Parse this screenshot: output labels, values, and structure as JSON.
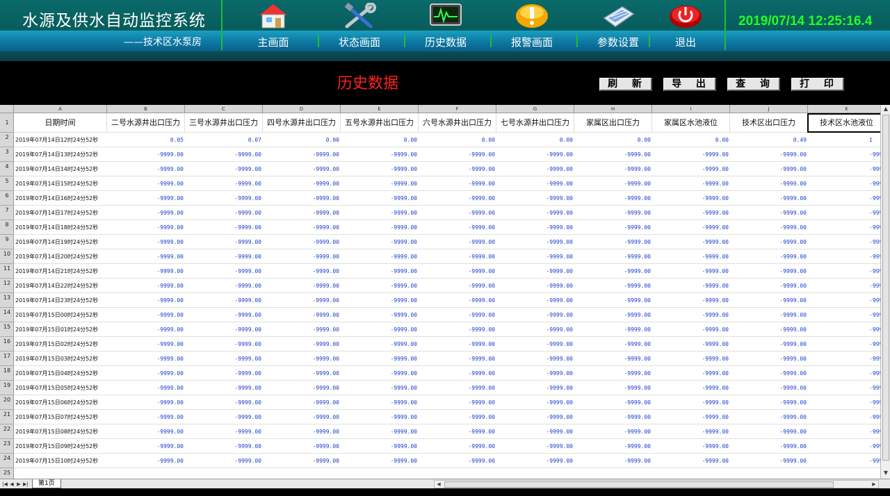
{
  "header": {
    "title": "水源及供水自动监控系统",
    "subtitle": "——技术区水泵房",
    "clock": "2019/07/14 12:25:16.4",
    "nav": [
      {
        "label": "主画面",
        "icon": "home-icon"
      },
      {
        "label": "状态画面",
        "icon": "tools-icon"
      },
      {
        "label": "历史数据",
        "icon": "monitor-icon"
      },
      {
        "label": "报警画面",
        "icon": "alarm-icon"
      },
      {
        "label": "参数设置",
        "icon": "keyboard-icon"
      },
      {
        "label": "退出",
        "icon": "power-icon"
      }
    ]
  },
  "toolbar": {
    "page_title": "历史数据",
    "refresh": "刷 新",
    "export": "导 出",
    "query": "查 询",
    "print": "打 印"
  },
  "sheet": {
    "col_letters": [
      "A",
      "B",
      "C",
      "D",
      "E",
      "F",
      "G",
      "H",
      "I",
      "J",
      "K"
    ],
    "headers": [
      "日期时间",
      "二号水源井出口压力",
      "三号水源井出口压力",
      "四号水源井出口压力",
      "五号水源井出口压力",
      "六号水源井出口压力",
      "七号水源井出口压力",
      "家属区出口压力",
      "家属区水池液位",
      "技术区出口压力",
      "技术区水池液位"
    ],
    "rows": [
      {
        "t": "2019年07月14日12时24分52秒",
        "v": [
          "0.05",
          "0.07",
          "0.00",
          "0.00",
          "0.00",
          "0.00",
          "0.00",
          "0.00",
          "0.49",
          "1"
        ]
      },
      {
        "t": "2019年07月14日13时24分52秒",
        "v": [
          "-9999.00",
          "-9999.00",
          "-9999.00",
          "-9999.00",
          "-9999.00",
          "-9999.00",
          "-9999.00",
          "-9999.00",
          "-9999.00",
          "-999"
        ]
      },
      {
        "t": "2019年07月14日14时24分52秒",
        "v": [
          "-9999.00",
          "-9999.00",
          "-9999.00",
          "-9999.00",
          "-9999.00",
          "-9999.00",
          "-9999.00",
          "-9999.00",
          "-9999.00",
          "-999"
        ]
      },
      {
        "t": "2019年07月14日15时24分52秒",
        "v": [
          "-9999.00",
          "-9999.00",
          "-9999.00",
          "-9999.00",
          "-9999.00",
          "-9999.00",
          "-9999.00",
          "-9999.00",
          "-9999.00",
          "-999"
        ]
      },
      {
        "t": "2019年07月14日16时24分52秒",
        "v": [
          "-9999.00",
          "-9999.00",
          "-9999.00",
          "-9999.00",
          "-9999.00",
          "-9999.00",
          "-9999.00",
          "-9999.00",
          "-9999.00",
          "-999"
        ]
      },
      {
        "t": "2019年07月14日17时24分52秒",
        "v": [
          "-9999.00",
          "-9999.00",
          "-9999.00",
          "-9999.00",
          "-9999.00",
          "-9999.00",
          "-9999.00",
          "-9999.00",
          "-9999.00",
          "-999"
        ]
      },
      {
        "t": "2019年07月14日18时24分52秒",
        "v": [
          "-9999.00",
          "-9999.00",
          "-9999.00",
          "-9999.00",
          "-9999.00",
          "-9999.00",
          "-9999.00",
          "-9999.00",
          "-9999.00",
          "-999"
        ]
      },
      {
        "t": "2019年07月14日19时24分52秒",
        "v": [
          "-9999.00",
          "-9999.00",
          "-9999.00",
          "-9999.00",
          "-9999.00",
          "-9999.00",
          "-9999.00",
          "-9999.00",
          "-9999.00",
          "-999"
        ]
      },
      {
        "t": "2019年07月14日20时24分52秒",
        "v": [
          "-9999.00",
          "-9999.00",
          "-9999.00",
          "-9999.00",
          "-9999.00",
          "-9999.00",
          "-9999.00",
          "-9999.00",
          "-9999.00",
          "-999"
        ]
      },
      {
        "t": "2019年07月14日21时24分52秒",
        "v": [
          "-9999.00",
          "-9999.00",
          "-9999.00",
          "-9999.00",
          "-9999.00",
          "-9999.00",
          "-9999.00",
          "-9999.00",
          "-9999.00",
          "-999"
        ]
      },
      {
        "t": "2019年07月14日22时24分52秒",
        "v": [
          "-9999.00",
          "-9999.00",
          "-9999.00",
          "-9999.00",
          "-9999.00",
          "-9999.00",
          "-9999.00",
          "-9999.00",
          "-9999.00",
          "-999"
        ]
      },
      {
        "t": "2019年07月14日23时24分52秒",
        "v": [
          "-9999.00",
          "-9999.00",
          "-9999.00",
          "-9999.00",
          "-9999.00",
          "-9999.00",
          "-9999.00",
          "-9999.00",
          "-9999.00",
          "-999"
        ]
      },
      {
        "t": "2019年07月15日00时24分52秒",
        "v": [
          "-9999.00",
          "-9999.00",
          "-9999.00",
          "-9999.00",
          "-9999.00",
          "-9999.00",
          "-9999.00",
          "-9999.00",
          "-9999.00",
          "-999"
        ]
      },
      {
        "t": "2019年07月15日01时24分52秒",
        "v": [
          "-9999.00",
          "-9999.00",
          "-9999.00",
          "-9999.00",
          "-9999.00",
          "-9999.00",
          "-9999.00",
          "-9999.00",
          "-9999.00",
          "-999"
        ]
      },
      {
        "t": "2019年07月15日02时24分52秒",
        "v": [
          "-9999.00",
          "-9999.00",
          "-9999.00",
          "-9999.00",
          "-9999.00",
          "-9999.00",
          "-9999.00",
          "-9999.00",
          "-9999.00",
          "-999"
        ]
      },
      {
        "t": "2019年07月15日03时24分52秒",
        "v": [
          "-9999.00",
          "-9999.00",
          "-9999.00",
          "-9999.00",
          "-9999.00",
          "-9999.00",
          "-9999.00",
          "-9999.00",
          "-9999.00",
          "-999"
        ]
      },
      {
        "t": "2019年07月15日04时24分52秒",
        "v": [
          "-9999.00",
          "-9999.00",
          "-9999.00",
          "-9999.00",
          "-9999.00",
          "-9999.00",
          "-9999.00",
          "-9999.00",
          "-9999.00",
          "-999"
        ]
      },
      {
        "t": "2019年07月15日05时24分52秒",
        "v": [
          "-9999.00",
          "-9999.00",
          "-9999.00",
          "-9999.00",
          "-9999.00",
          "-9999.00",
          "-9999.00",
          "-9999.00",
          "-9999.00",
          "-999"
        ]
      },
      {
        "t": "2019年07月15日06时24分52秒",
        "v": [
          "-9999.00",
          "-9999.00",
          "-9999.00",
          "-9999.00",
          "-9999.00",
          "-9999.00",
          "-9999.00",
          "-9999.00",
          "-9999.00",
          "-999"
        ]
      },
      {
        "t": "2019年07月15日07时24分52秒",
        "v": [
          "-9999.00",
          "-9999.00",
          "-9999.00",
          "-9999.00",
          "-9999.00",
          "-9999.00",
          "-9999.00",
          "-9999.00",
          "-9999.00",
          "-999"
        ]
      },
      {
        "t": "2019年07月15日08时24分52秒",
        "v": [
          "-9999.00",
          "-9999.00",
          "-9999.00",
          "-9999.00",
          "-9999.00",
          "-9999.00",
          "-9999.00",
          "-9999.00",
          "-9999.00",
          "-999"
        ]
      },
      {
        "t": "2019年07月15日09时24分52秒",
        "v": [
          "-9999.00",
          "-9999.00",
          "-9999.00",
          "-9999.00",
          "-9999.00",
          "-9999.00",
          "-9999.00",
          "-9999.00",
          "-9999.00",
          "-999"
        ]
      },
      {
        "t": "2019年07月15日10时24分52秒",
        "v": [
          "-9999.00",
          "-9999.00",
          "-9999.00",
          "-9999.00",
          "-9999.00",
          "-9999.00",
          "-9999.00",
          "-9999.00",
          "-9999.00",
          "-999"
        ]
      }
    ],
    "sheet_tab": "第1页"
  },
  "colors": {
    "header_bg": "#085c5c",
    "accent_green": "#22ff22",
    "title_red": "#ff2020",
    "value_blue": "#1f3fd0"
  }
}
